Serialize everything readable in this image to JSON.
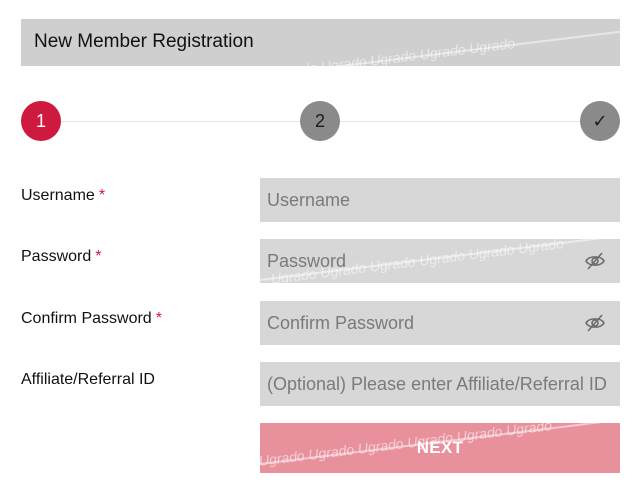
{
  "header": {
    "title": "New Member Registration"
  },
  "watermark": {
    "text": "Ugrado Ugrado Ugrado Ugrado Ugrado Ugrado"
  },
  "stepper": {
    "steps": [
      {
        "label": "1",
        "state": "active"
      },
      {
        "label": "2",
        "state": "pending"
      },
      {
        "label": "✓",
        "state": "pending"
      }
    ]
  },
  "form": {
    "required_mark": "*",
    "username": {
      "label": "Username",
      "placeholder": "Username",
      "value": ""
    },
    "password": {
      "label": "Password",
      "placeholder": "Password",
      "value": ""
    },
    "confirm_password": {
      "label": "Confirm Password",
      "placeholder": "Confirm Password",
      "value": ""
    },
    "affiliate": {
      "label": "Affiliate/Referral ID",
      "placeholder": "(Optional) Please enter Affiliate/Referral ID",
      "value": ""
    },
    "next_label": "NEXT"
  },
  "colors": {
    "accent": "#d0193f",
    "pending_step": "#8a8a8a",
    "field_bg": "#d7d7d7",
    "header_bg": "#cfcfcf",
    "button_bg": "#e8919d"
  },
  "icons": {
    "password_toggle": "eye-off-icon"
  }
}
